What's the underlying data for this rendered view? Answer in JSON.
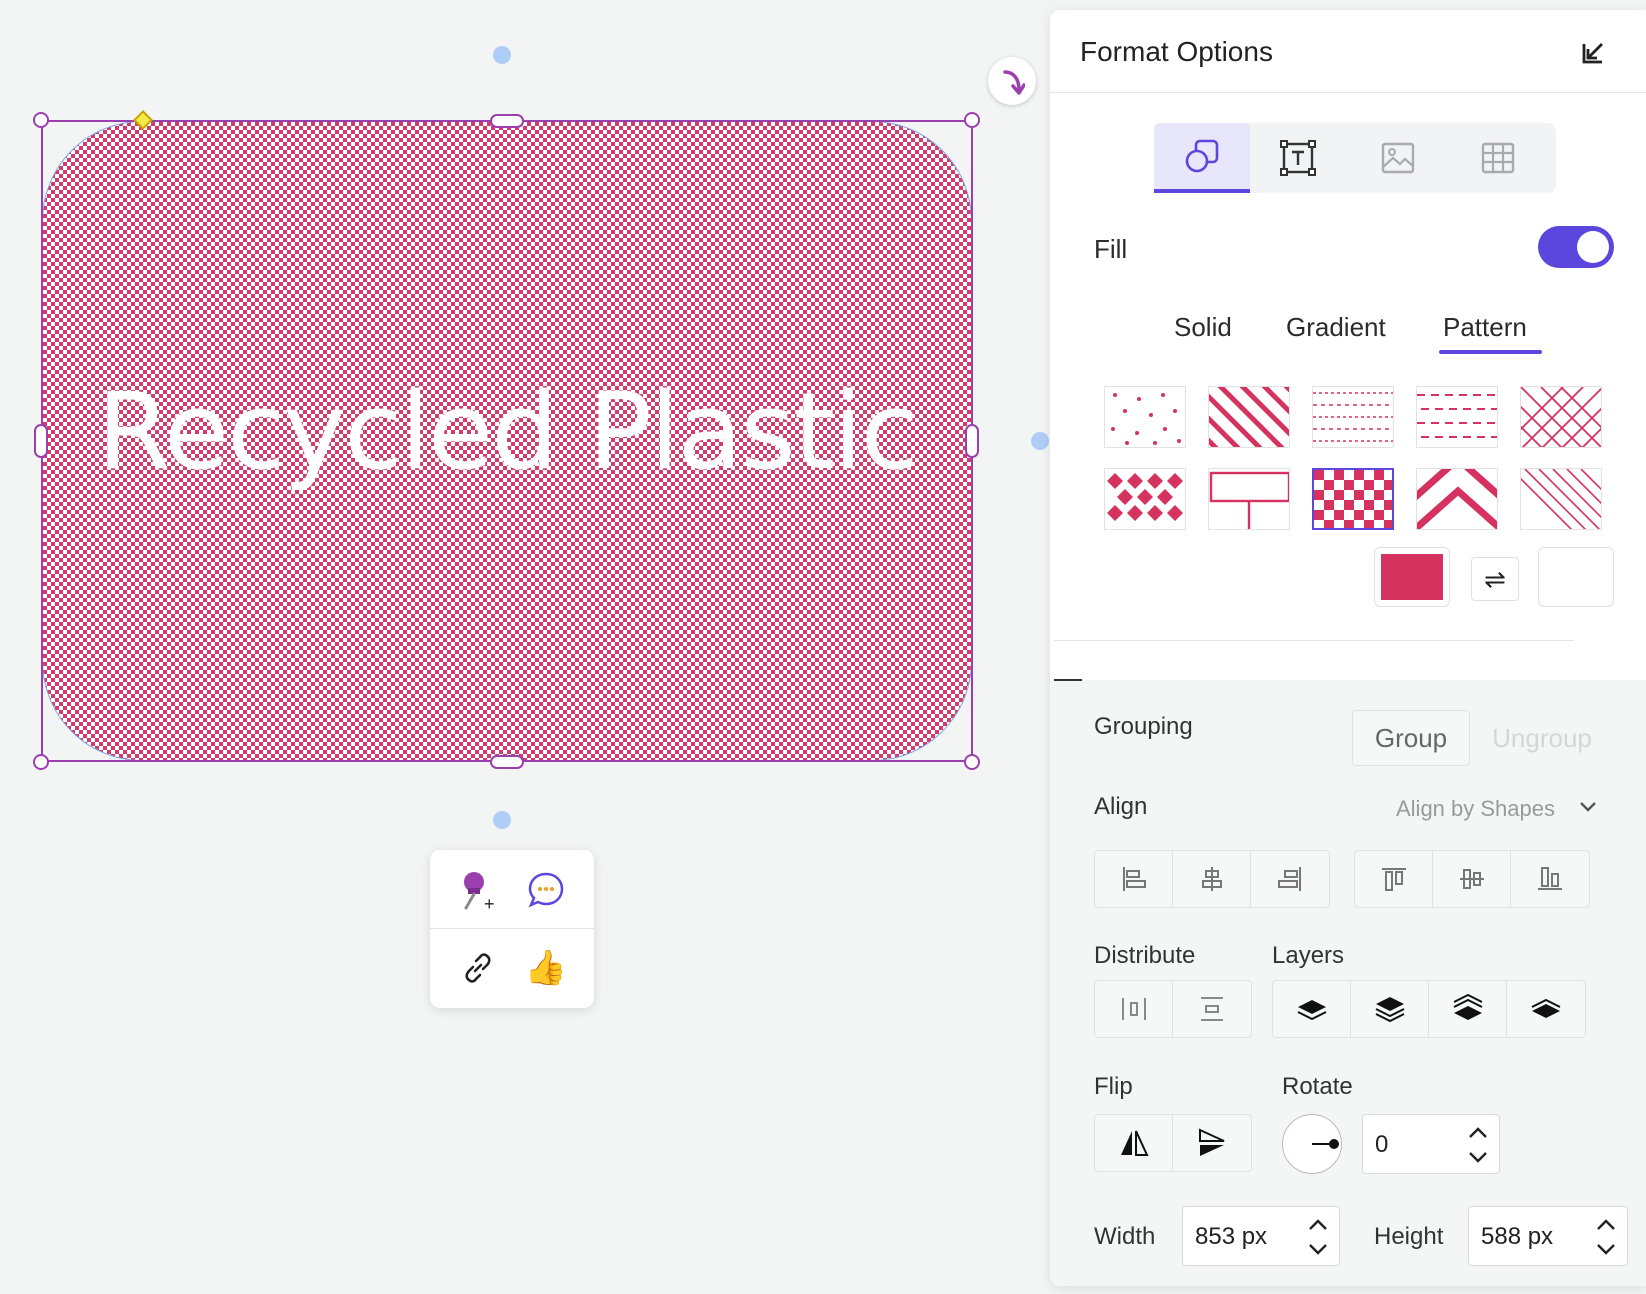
{
  "canvas": {
    "shape_text": "Recycled Plastic",
    "fill_color": "#d6325f"
  },
  "mini_toolbar": {
    "pin_icon": "pushpin-add-icon",
    "comment_icon": "comment-icon",
    "link_icon": "link-icon",
    "reaction_icon": "thumbs-up-icon",
    "reaction_glyph": "👍"
  },
  "panel": {
    "title": "Format Options",
    "tabs": [
      "shape-icon",
      "text-icon",
      "image-icon",
      "table-icon"
    ],
    "fill": {
      "label": "Fill",
      "enabled": true,
      "types": [
        "Solid",
        "Gradient",
        "Pattern"
      ],
      "active_type": "Pattern",
      "pattern_selected_index": 7,
      "foreground": "#d6325f",
      "background": "#ffffff",
      "swap_glyph": "⇌"
    },
    "grouping": {
      "label": "Grouping",
      "group": "Group",
      "ungroup": "Ungroup"
    },
    "align": {
      "label": "Align",
      "mode": "Align by Shapes"
    },
    "distribute": {
      "label": "Distribute"
    },
    "layers": {
      "label": "Layers"
    },
    "flip": {
      "label": "Flip"
    },
    "rotate": {
      "label": "Rotate",
      "value": "0"
    },
    "width": {
      "label": "Width",
      "value": "853 px"
    },
    "height": {
      "label": "Height",
      "value": "588 px"
    }
  },
  "colors": {
    "accent": "#5b47de",
    "selection": "#9b3fae"
  }
}
